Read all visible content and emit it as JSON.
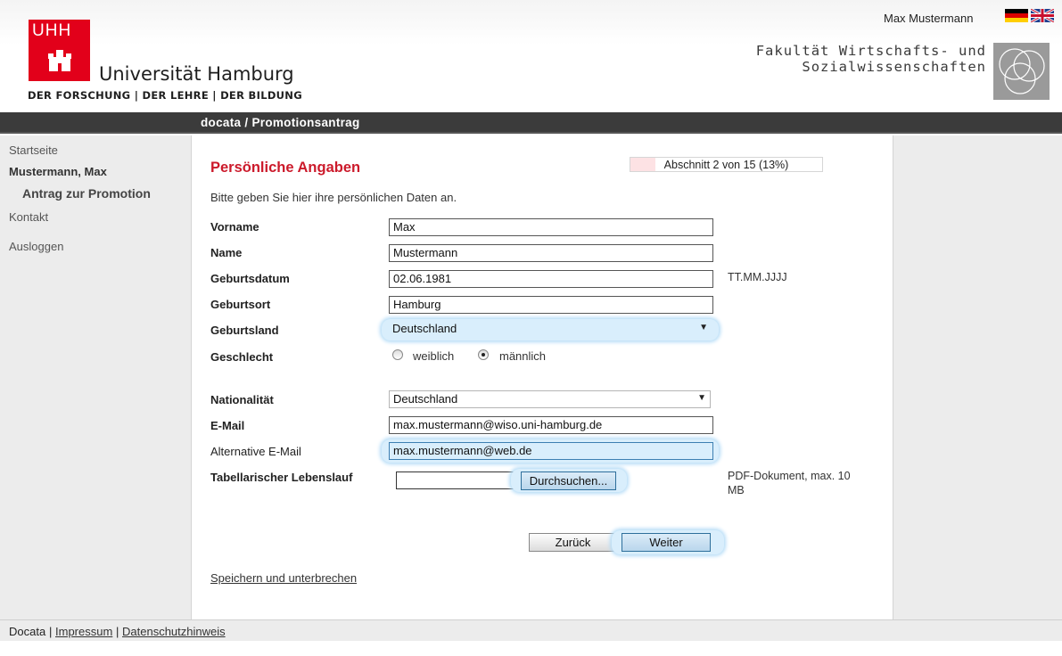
{
  "header": {
    "logo_text": "UHH",
    "university": "Universität Hamburg",
    "tagline": "DER FORSCHUNG  |  DER LEHRE  |  DER BILDUNG",
    "user": "Max Mustermann",
    "faculty_line1": "Fakultät Wirtschafts- und",
    "faculty_line2": "Sozialwissenschaften",
    "lang_icons": [
      "flag-de-icon",
      "flag-en-icon"
    ]
  },
  "titlebar": {
    "title": "docata / Promotionsantrag"
  },
  "sidebar": {
    "start": "Startseite",
    "user": "Mustermann, Max",
    "antrag": "Antrag zur Promotion",
    "kontakt": "Kontakt",
    "logout": "Ausloggen"
  },
  "main": {
    "title": "Persönliche Angaben",
    "progress_text": "Abschnitt 2 von 15 (13%)",
    "progress_fraction": 0.13,
    "intro": "Bitte geben Sie hier ihre persönlichen Daten an."
  },
  "form": {
    "vorname": {
      "label": "Vorname",
      "value": "Max"
    },
    "name": {
      "label": "Name",
      "value": "Mustermann"
    },
    "geburtsdatum": {
      "label": "Geburtsdatum",
      "value": "02.06.1981",
      "hint": "TT.MM.JJJJ"
    },
    "geburtsort": {
      "label": "Geburtsort",
      "value": "Hamburg"
    },
    "geburtsland": {
      "label": "Geburtsland",
      "value": "Deutschland"
    },
    "geschlecht": {
      "label": "Geschlecht",
      "female": "weiblich",
      "male": "männlich",
      "selected": "männlich"
    },
    "nationalitaet": {
      "label": "Nationalität",
      "value": "Deutschland"
    },
    "email": {
      "label": "E-Mail",
      "value": "max.mustermann@wiso.uni-hamburg.de"
    },
    "alt_email": {
      "label": "Alternative E-Mail",
      "value": "max.mustermann@web.de"
    },
    "lebenslauf": {
      "label": "Tabellarischer Lebenslauf",
      "value": "",
      "browse": "Durchsuchen...",
      "hint": "PDF-Dokument, max. 10 MB"
    }
  },
  "buttons": {
    "back": "Zurück",
    "next": "Weiter",
    "save": "Speichern und unterbrechen"
  },
  "footer": {
    "docata": "Docata",
    "sep": "|",
    "impressum": "Impressum",
    "datenschutz": "Datenschutzhinweis"
  },
  "colors": {
    "accent_red": "#cc1a2b",
    "brand_red": "#e2001a",
    "focus_blue": "#d9eefc",
    "bar_dark": "#3b3b3b"
  }
}
